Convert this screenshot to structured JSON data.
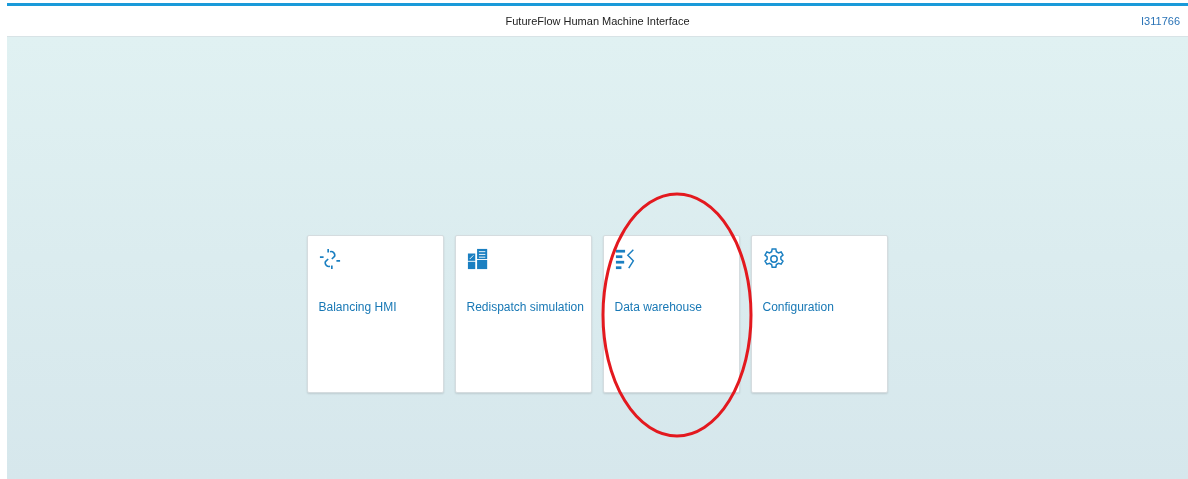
{
  "header": {
    "title": "FutureFlow Human Machine Interface",
    "user": "I311766"
  },
  "tiles": [
    {
      "kind": "link",
      "label": "Balancing HMI"
    },
    {
      "kind": "table",
      "label": "Redispatch simulation"
    },
    {
      "kind": "warehouse",
      "label": "Data warehouse"
    },
    {
      "kind": "gear",
      "label": "Configuration"
    }
  ],
  "annotation": {
    "kind": "ellipse"
  }
}
